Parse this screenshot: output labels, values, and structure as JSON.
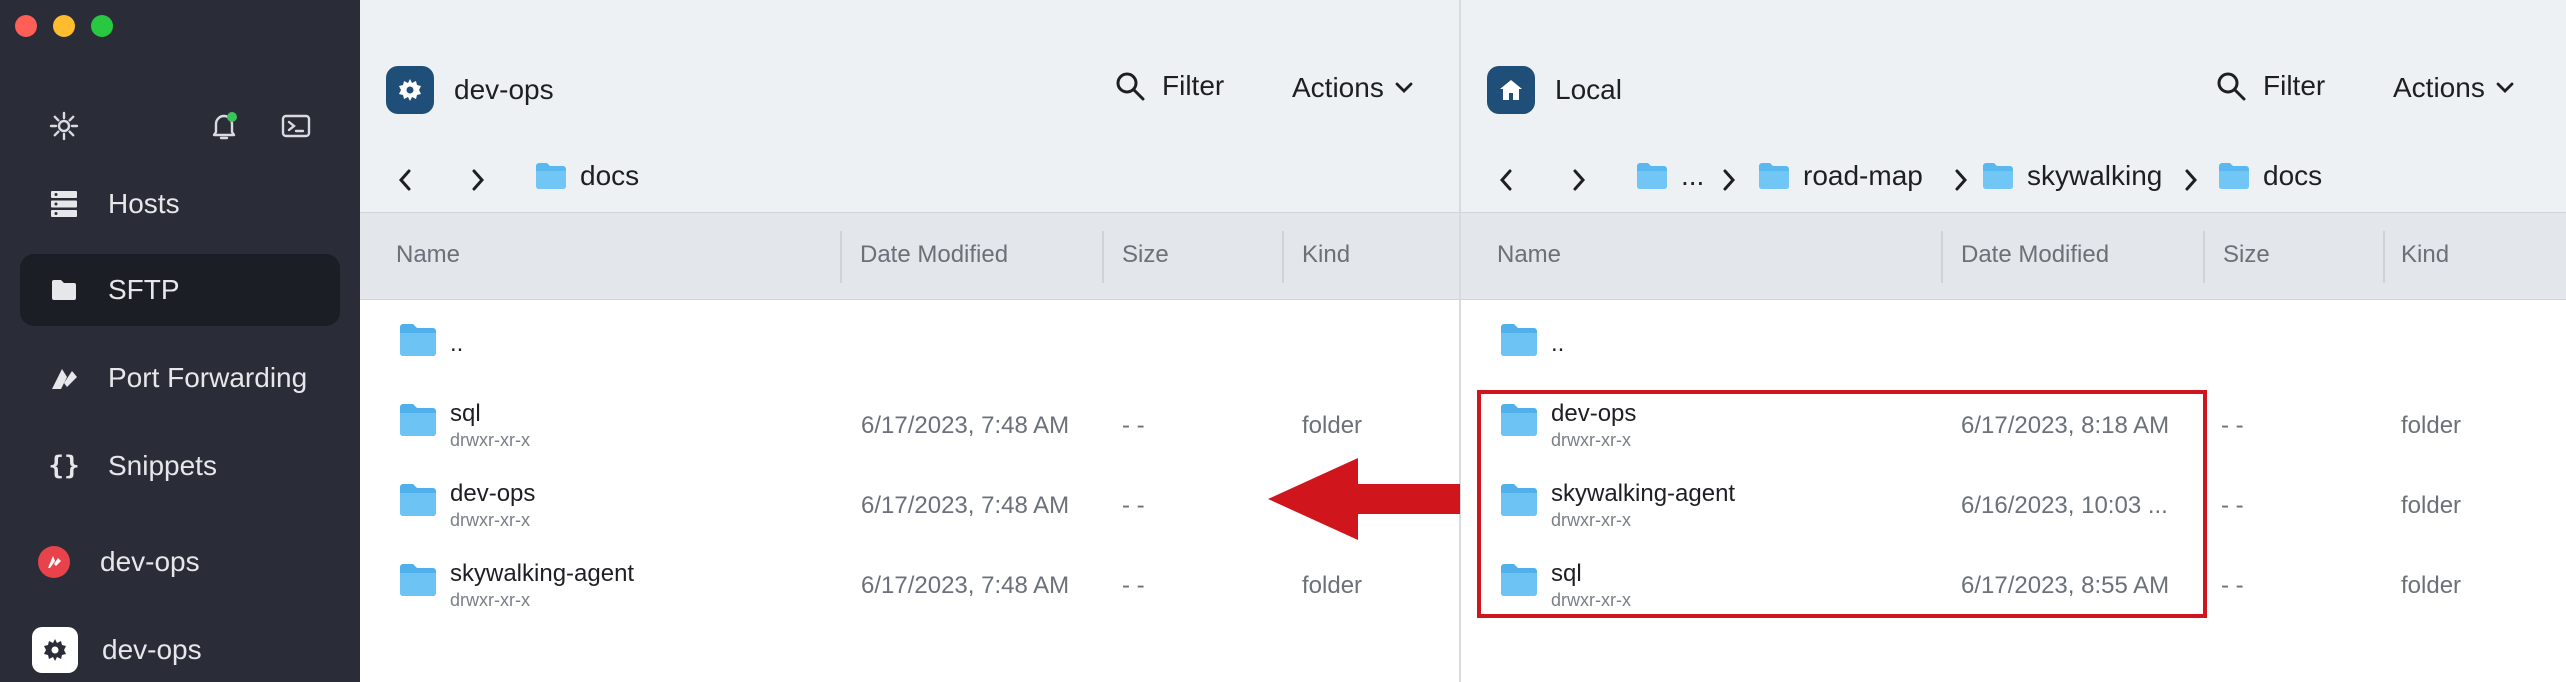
{
  "sidebar": {
    "tools": {
      "settings": "gear-icon",
      "notifications": "bell-icon",
      "terminal": "terminal-icon"
    },
    "items": [
      {
        "label": "Hosts",
        "icon": "hosts-icon",
        "active": false
      },
      {
        "label": "SFTP",
        "icon": "folder-icon",
        "active": true
      },
      {
        "label": "Port Forwarding",
        "icon": "port-forwarding-icon",
        "active": false
      },
      {
        "label": "Snippets",
        "icon": "braces-icon",
        "active": false
      }
    ],
    "hosts": [
      {
        "label": "dev-ops",
        "icon": "red-host-icon"
      },
      {
        "label": "dev-ops",
        "icon": "gear-host-icon"
      }
    ]
  },
  "left": {
    "title": "dev-ops",
    "filter_label": "Filter",
    "actions_label": "Actions",
    "breadcrumb": [
      "docs"
    ],
    "columns": {
      "name": "Name",
      "date": "Date Modified",
      "size": "Size",
      "kind": "Kind"
    },
    "parent": "..",
    "rows": [
      {
        "name": "sql",
        "perm": "drwxr-xr-x",
        "date": "6/17/2023, 7:48 AM",
        "size": "- -",
        "kind": "folder"
      },
      {
        "name": "dev-ops",
        "perm": "drwxr-xr-x",
        "date": "6/17/2023, 7:48 AM",
        "size": "- -",
        "kind": ""
      },
      {
        "name": "skywalking-agent",
        "perm": "drwxr-xr-x",
        "date": "6/17/2023, 7:48 AM",
        "size": "- -",
        "kind": "folder"
      }
    ]
  },
  "right": {
    "title": "Local",
    "filter_label": "Filter",
    "actions_label": "Actions",
    "breadcrumb": [
      "...",
      "road-map",
      "skywalking",
      "docs"
    ],
    "columns": {
      "name": "Name",
      "date": "Date Modified",
      "size": "Size",
      "kind": "Kind"
    },
    "parent": "..",
    "rows": [
      {
        "name": "dev-ops",
        "perm": "drwxr-xr-x",
        "date": "6/17/2023, 8:18 AM",
        "size": "- -",
        "kind": "folder"
      },
      {
        "name": "skywalking-agent",
        "perm": "drwxr-xr-x",
        "date": "6/16/2023, 10:03 ...",
        "size": "- -",
        "kind": "folder"
      },
      {
        "name": "sql",
        "perm": "drwxr-xr-x",
        "date": "6/17/2023, 8:55 AM",
        "size": "- -",
        "kind": "folder"
      }
    ]
  },
  "colors": {
    "highlight": "#d1151d",
    "folder": "#5ab8f0",
    "sidebar": "#2a2d37"
  }
}
